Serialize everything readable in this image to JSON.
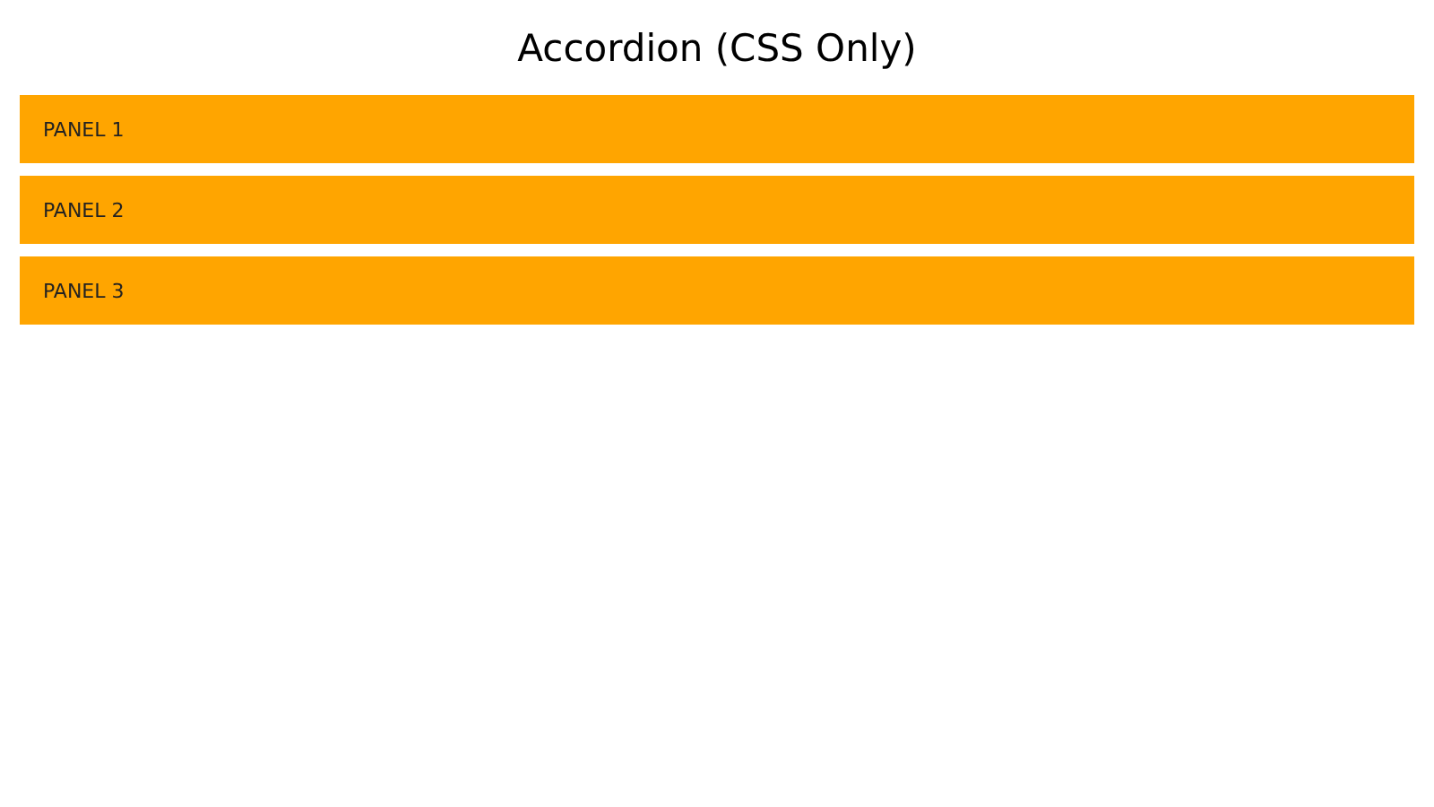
{
  "title": "Accordion (CSS Only)",
  "panels": [
    {
      "label": "PANEL 1"
    },
    {
      "label": "PANEL 2"
    },
    {
      "label": "PANEL 3"
    }
  ]
}
